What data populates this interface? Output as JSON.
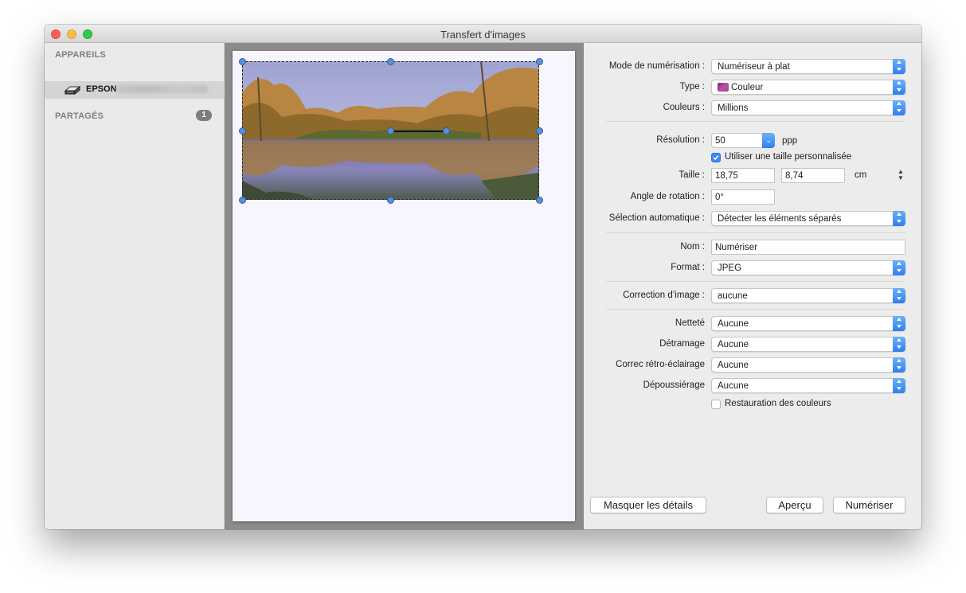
{
  "window": {
    "title": "Transfert d'images"
  },
  "sidebar": {
    "devices_header": "APPAREILS",
    "device_name": "EPSON",
    "shared_header": "PARTAGÉS",
    "shared_count": "1"
  },
  "settings": {
    "mode": {
      "label": "Mode de numérisation :",
      "value": "Numériseur à plat"
    },
    "type": {
      "label": "Type :",
      "value": "Couleur"
    },
    "colors": {
      "label": "Couleurs :",
      "value": "Millions"
    },
    "resolution": {
      "label": "Résolution :",
      "value": "50",
      "unit": "ppp"
    },
    "custom_size": {
      "label": "Utiliser une taille personnalisée",
      "checked": true
    },
    "size": {
      "label": "Taille :",
      "width": "18,75",
      "height": "8,74",
      "unit": "cm"
    },
    "rotation": {
      "label": "Angle de rotation :",
      "value": "0°"
    },
    "auto_select": {
      "label": "Sélection automatique :",
      "value": "Détecter les éléments séparés"
    },
    "name": {
      "label": "Nom :",
      "value": "Numériser"
    },
    "format": {
      "label": "Format :",
      "value": "JPEG"
    },
    "image_correction": {
      "label": "Correction d’image :",
      "value": "aucune"
    },
    "sharpness": {
      "label": "Netteté",
      "value": "Aucune"
    },
    "descreening": {
      "label": "Détramage",
      "value": "Aucune"
    },
    "backlight": {
      "label": "Correc rétro-éclairage",
      "value": "Aucune"
    },
    "dust": {
      "label": "Dépoussiérage",
      "value": "Aucune"
    },
    "color_restore": {
      "label": "Restauration des couleurs",
      "checked": false
    }
  },
  "buttons": {
    "hide_details": "Masquer les détails",
    "preview": "Aperçu",
    "scan": "Numériser"
  },
  "colors": {
    "accent": "#3b8af4",
    "sidebar_bg": "#eaeaea",
    "preview_bg": "#8b8b8b"
  },
  "icons": [
    "printer-icon",
    "popup-arrows-icon",
    "color-type-icon",
    "checkbox-icon",
    "stepper-icon"
  ]
}
